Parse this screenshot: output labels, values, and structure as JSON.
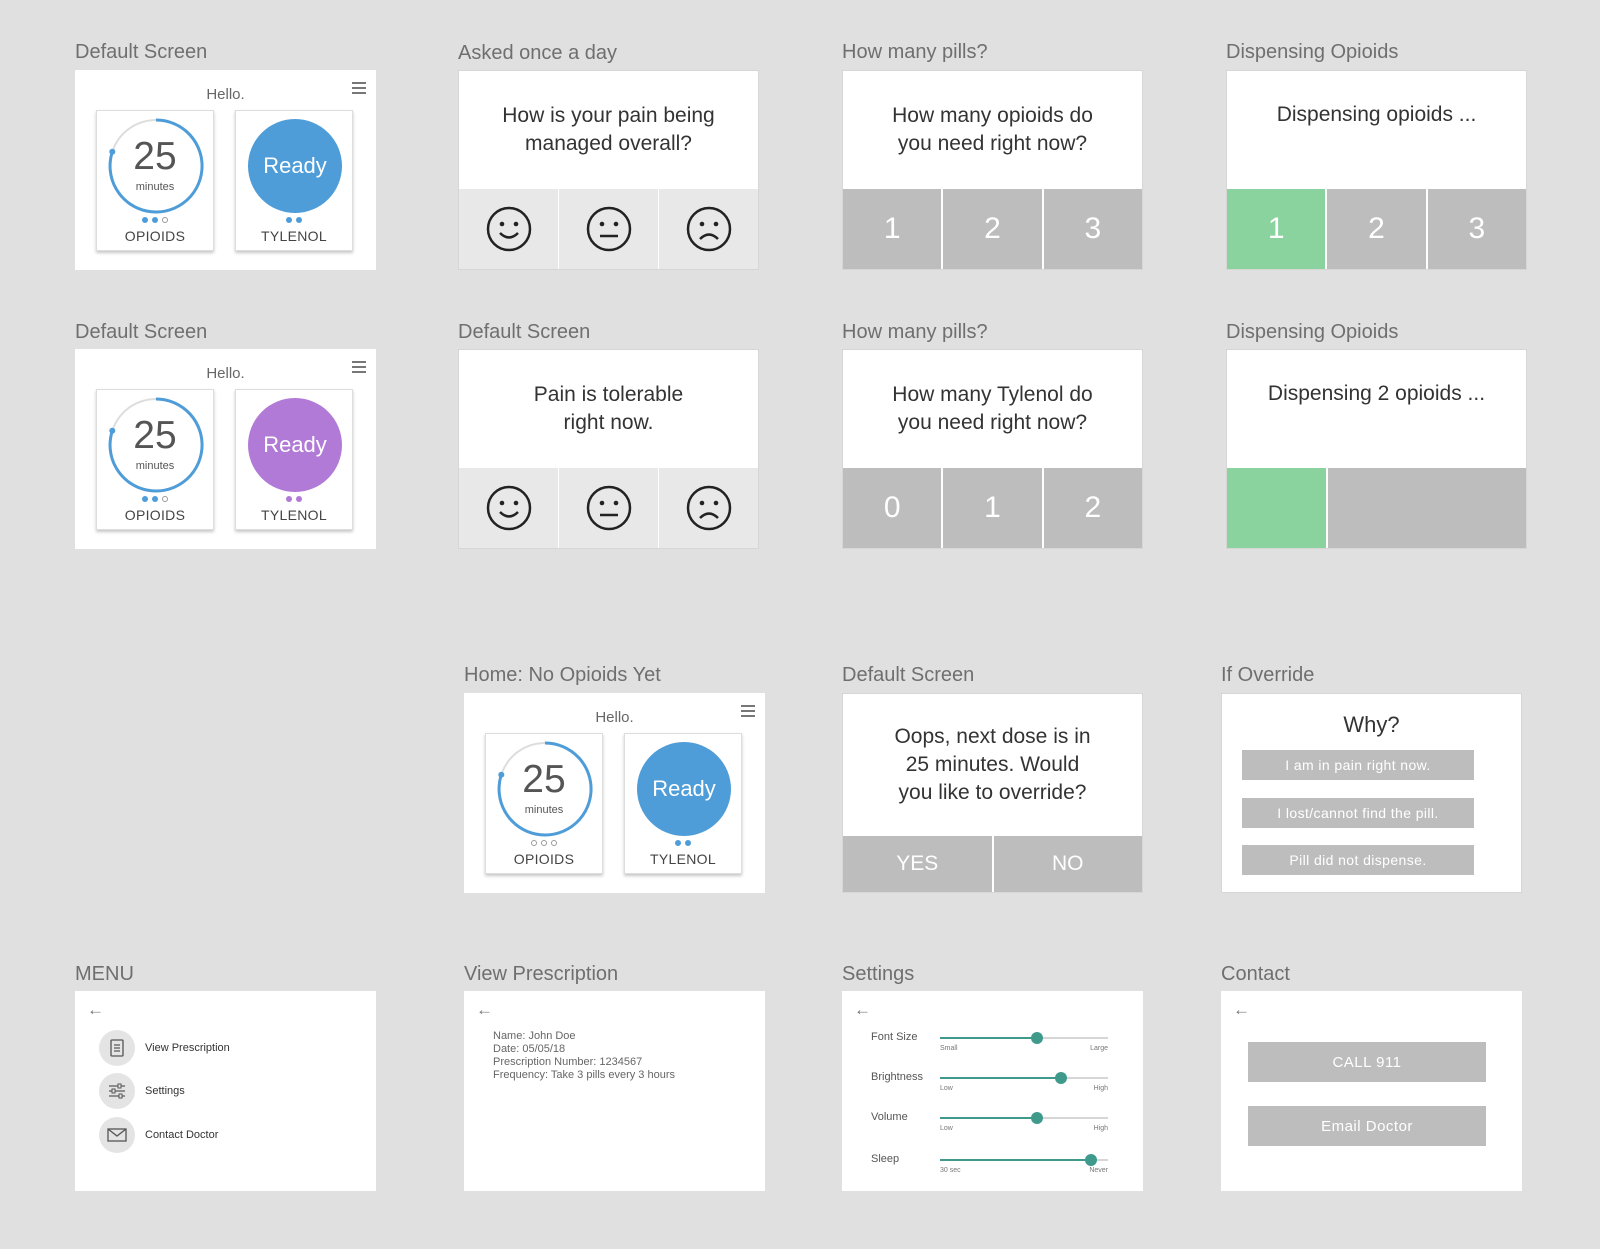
{
  "screens": {
    "home1": {
      "label": "Default Screen",
      "hello": "Hello.",
      "timer": "25",
      "timer_unit": "minutes",
      "ready": "Ready",
      "opioids": "OPIOIDS",
      "tylenol": "TYLENOL"
    },
    "home2": {
      "label": "Default Screen",
      "hello": "Hello.",
      "timer": "25",
      "timer_unit": "minutes",
      "ready": "Ready",
      "opioids": "OPIOIDS",
      "tylenol": "TYLENOL"
    },
    "home3": {
      "label": "Home: No Opioids Yet",
      "hello": "Hello.",
      "timer": "25",
      "timer_unit": "minutes",
      "ready": "Ready",
      "opioids": "OPIOIDS",
      "tylenol": "TYLENOL"
    },
    "pain_daily": {
      "label": "Asked once a day",
      "question": "How is your pain being\nmanaged overall?"
    },
    "pain_now": {
      "label": "Default Screen",
      "question": "Pain is tolerable\nright now."
    },
    "opioid_count": {
      "label": "How many pills?",
      "question": "How many opioids do\nyou need right now?",
      "options": [
        "1",
        "2",
        "3"
      ]
    },
    "tylenol_count": {
      "label": "How many pills?",
      "question": "How many Tylenol do\nyou need right now?",
      "options": [
        "0",
        "1",
        "2"
      ]
    },
    "dispense1": {
      "label": "Dispensing Opioids",
      "text": "Dispensing opioids ...",
      "options": [
        "1",
        "2",
        "3"
      ]
    },
    "dispense2": {
      "label": "Dispensing Opioids",
      "text": "Dispensing 2 opioids ..."
    },
    "oops": {
      "label": "Default Screen",
      "question": "Oops, next dose is in\n25 minutes. Would\nyou like to override?",
      "yes": "YES",
      "no": "NO"
    },
    "override": {
      "label": "If Override",
      "title": "Why?",
      "reasons": [
        "I am in pain right now.",
        "I lost/cannot find the pill.",
        "Pill did not dispense."
      ]
    },
    "menu": {
      "label": "MENU",
      "back": "←",
      "items": [
        "View Prescription",
        "Settings",
        "Contact Doctor"
      ]
    },
    "prescription": {
      "label": "View Prescription",
      "back": "←",
      "lines": [
        "Name: John Doe",
        "Date: 05/05/18",
        "Prescription Number: 1234567",
        "Frequency: Take 3 pills every 3 hours"
      ]
    },
    "settings": {
      "label": "Settings",
      "back": "←",
      "sliders": [
        {
          "name": "Font Size",
          "low": "Small",
          "high": "Large",
          "value": 0.58
        },
        {
          "name": "Brightness",
          "low": "Low",
          "high": "High",
          "value": 0.72
        },
        {
          "name": "Volume",
          "low": "Low",
          "high": "High",
          "value": 0.58
        },
        {
          "name": "Sleep",
          "low": "30 sec",
          "high": "Never",
          "value": 0.9
        }
      ]
    },
    "contact": {
      "label": "Contact",
      "back": "←",
      "call": "CALL 911",
      "email": "Email Doctor"
    }
  },
  "colors": {
    "blue": "#4e9cd8",
    "purple": "#b17ad6",
    "green": "#8bd39e",
    "gray": "#bdbdbd",
    "teal": "#3f9a8c"
  }
}
